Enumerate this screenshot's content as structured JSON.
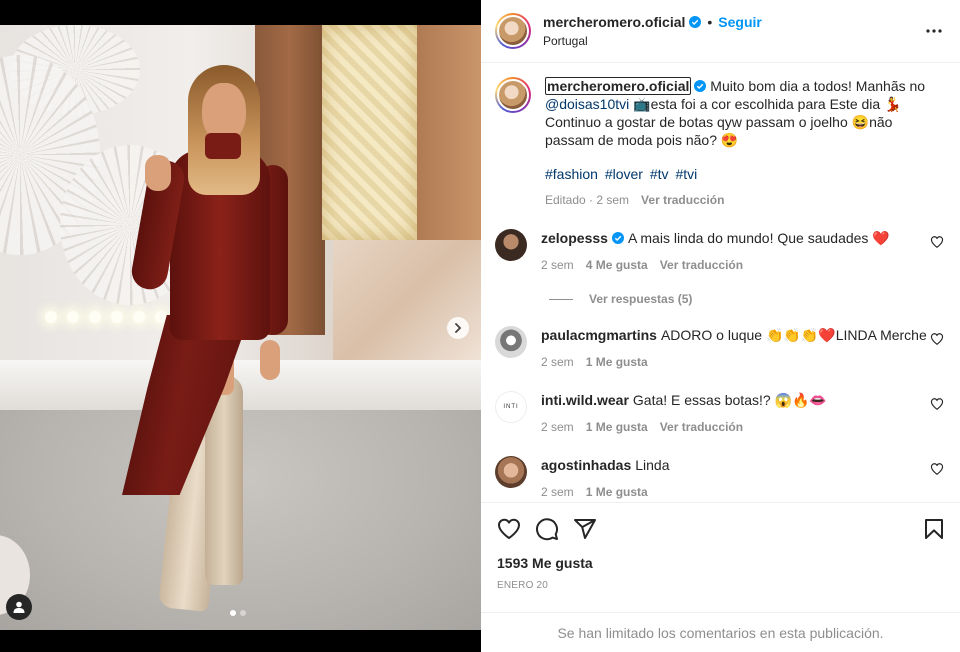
{
  "post": {
    "username": "mercheromero.oficial",
    "follow_label": "Seguir",
    "separator": "•",
    "location": "Portugal"
  },
  "caption": {
    "username": "mercheromero.oficial",
    "text_1": " Muito bom dia a todos! Manhãs no ",
    "mention": "@doisas10tvi",
    "emoji_1": " 📺",
    "text_2": "esta foi a cor escolhida para Este dia ",
    "emoji_2": "💃",
    "text_3": " Continuo a gostar de botas qyw passam o joelho ",
    "emoji_3": "😆",
    "text_4": "não passam de moda pois não? ",
    "emoji_4": "😍",
    "hashtags": [
      "#fashion",
      "#lover",
      "#tv",
      "#tvi"
    ],
    "edited": "Editado · 2 sem",
    "translate": "Ver traducción"
  },
  "comments": [
    {
      "username": "zelopesss",
      "text": "A mais linda do mundo! Que saudades ❤️",
      "time": "2 sem",
      "likes": "4 Me gusta",
      "translate": "Ver traducción",
      "replies": "Ver respuestas (5)"
    },
    {
      "username": "paulacmgmartins",
      "text": "ADORO o luque 👏👏👏❤️LINDA Merche",
      "time": "2 sem",
      "likes": "1 Me gusta",
      "translate": ""
    },
    {
      "username": "inti.wild.wear",
      "text": "Gata! E essas botas!? 😱🔥👄",
      "time": "2 sem",
      "likes": "1 Me gusta",
      "translate": "Ver traducción"
    },
    {
      "username": "agostinhadas",
      "text": "Linda",
      "time": "2 sem",
      "likes": "1 Me gusta",
      "translate": ""
    }
  ],
  "stats": {
    "likes": "1593 Me gusta",
    "date": "Enero 20"
  },
  "footer": {
    "limited": "Se han limitado los comentarios en esta publicación."
  },
  "colors": {
    "accent": "#0095f6",
    "verified": "#0095f6",
    "heart": "#ed4956"
  },
  "icons": [
    "more-options-icon",
    "verified-badge-icon",
    "heart-icon",
    "comment-icon",
    "share-icon",
    "bookmark-icon",
    "chevron-right-icon",
    "user-tag-icon"
  ]
}
